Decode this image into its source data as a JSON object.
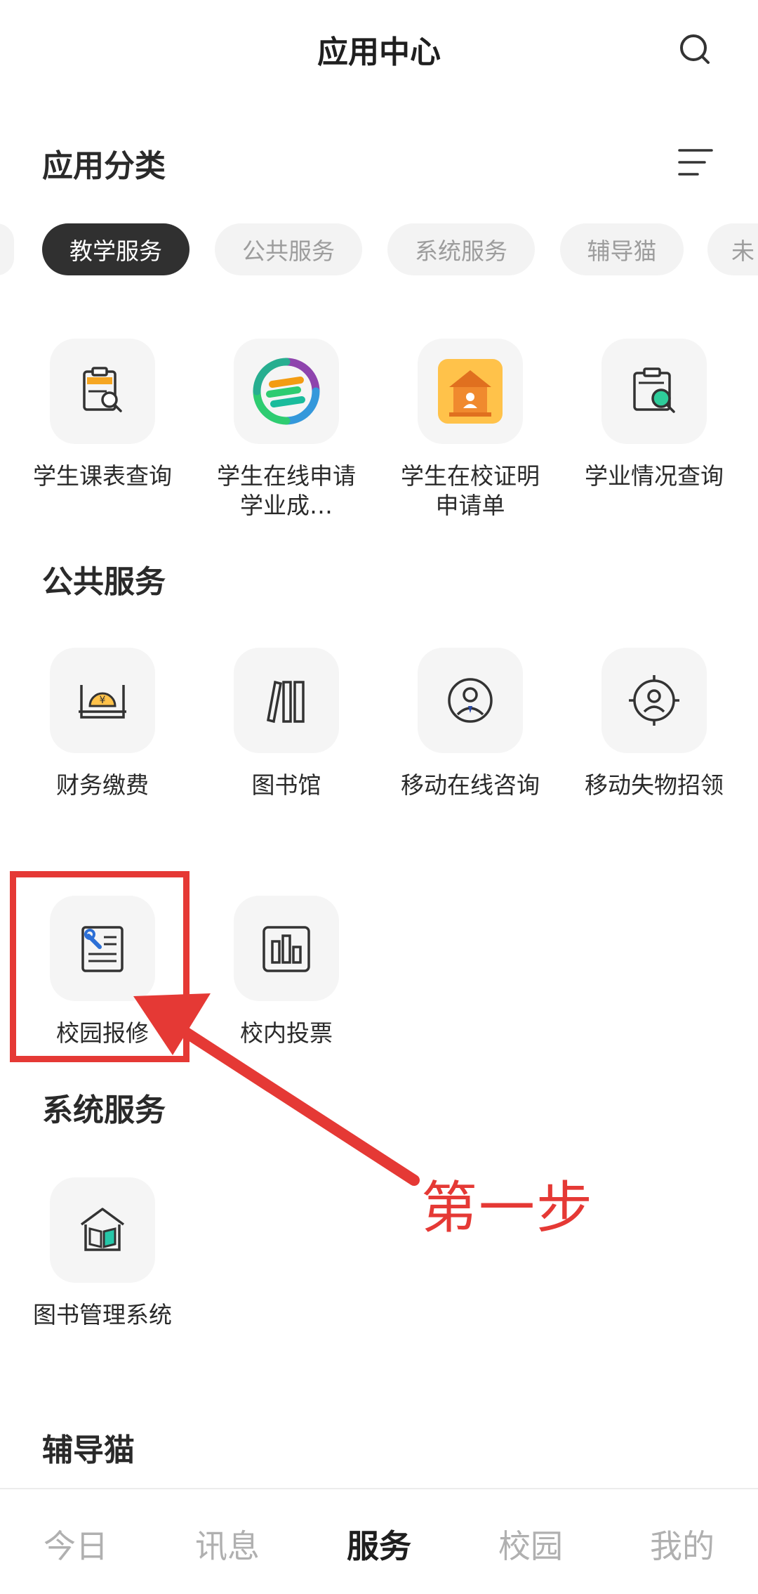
{
  "header": {
    "title": "应用中心",
    "search_icon": "search-icon"
  },
  "category_section": {
    "title": "应用分类",
    "filter_icon": "filter-icon"
  },
  "categories": [
    {
      "label": "教学服务",
      "active": true
    },
    {
      "label": "公共服务",
      "active": false
    },
    {
      "label": "系统服务",
      "active": false
    },
    {
      "label": "辅导猫",
      "active": false
    },
    {
      "label": "未",
      "active": false
    }
  ],
  "teaching": {
    "apps": [
      {
        "label": "学生课表查询",
        "icon": "schedule-search-icon"
      },
      {
        "label": "学生在线申请学业成…",
        "icon": "swirl-logo-icon"
      },
      {
        "label": "学生在校证明申请单",
        "icon": "school-certificate-icon"
      },
      {
        "label": "学业情况查询",
        "icon": "academic-search-icon"
      }
    ]
  },
  "public": {
    "title": "公共服务",
    "apps": [
      {
        "label": "财务缴费",
        "icon": "payment-icon"
      },
      {
        "label": "图书馆",
        "icon": "library-books-icon"
      },
      {
        "label": "移动在线咨询",
        "icon": "consult-person-icon"
      },
      {
        "label": "移动失物招领",
        "icon": "lost-found-icon"
      },
      {
        "label": "校园报修",
        "icon": "repair-icon"
      },
      {
        "label": "校内投票",
        "icon": "vote-chart-icon"
      }
    ]
  },
  "system": {
    "title": "系统服务",
    "apps": [
      {
        "label": "图书管理系统",
        "icon": "book-house-icon"
      }
    ]
  },
  "tutor": {
    "title": "辅导猫"
  },
  "annotation": {
    "text": "第一步",
    "color": "#e53935"
  },
  "nav": [
    {
      "label": "今日",
      "active": false
    },
    {
      "label": "讯息",
      "active": false
    },
    {
      "label": "服务",
      "active": true
    },
    {
      "label": "校园",
      "active": false
    },
    {
      "label": "我的",
      "active": false
    }
  ]
}
